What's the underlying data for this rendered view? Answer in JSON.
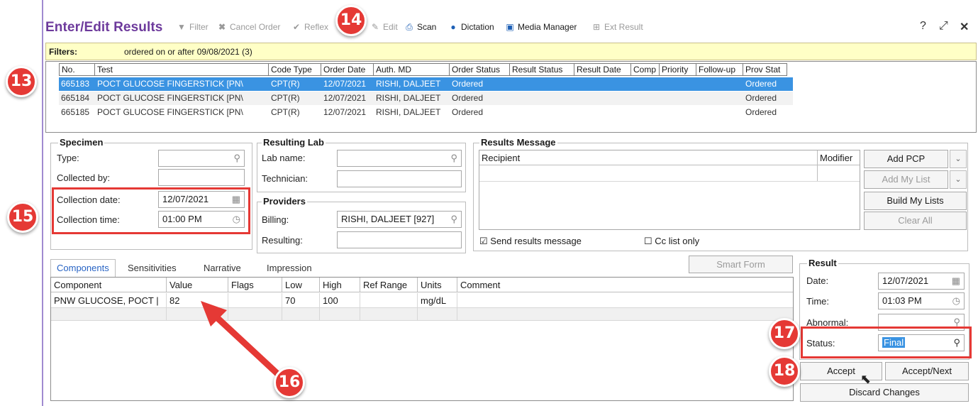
{
  "window": {
    "title": "Enter/Edit Results",
    "toolbar": [
      {
        "label": "Filter",
        "icon": "filter-icon",
        "enabled": false
      },
      {
        "label": "Cancel Order",
        "icon": "x-icon",
        "enabled": false
      },
      {
        "label": "Reflex",
        "icon": "check-arrow-icon",
        "enabled": false
      },
      {
        "label": "Edit",
        "icon": "pencil-icon",
        "enabled": false
      },
      {
        "label": "Scan",
        "icon": "scanner-icon",
        "enabled": true
      },
      {
        "label": "Dictation",
        "icon": "microphone-icon",
        "enabled": true
      },
      {
        "label": "Media Manager",
        "icon": "media-icon",
        "enabled": true
      },
      {
        "label": "Ext Result",
        "icon": "plus-box-icon",
        "enabled": false
      }
    ],
    "controls": {
      "help": "?",
      "maximize": "⤢",
      "close": "✕"
    }
  },
  "filters": {
    "label": "Filters:",
    "value": "ordered on or after 09/08/2021 (3)"
  },
  "orders": {
    "columns": [
      "No.",
      "Test",
      "Code Type",
      "Order Date",
      "Auth. MD",
      "Order Status",
      "Result Status",
      "Result Date",
      "Comp",
      "Priority",
      "Follow-up",
      "Prov Stat"
    ],
    "rows": [
      {
        "no": "665183",
        "test": "POCT GLUCOSE FINGERSTICK [PN\\",
        "code_type": "CPT(R)",
        "order_date": "12/07/2021",
        "auth_md": "RISHI, DALJEET",
        "order_status": "Ordered",
        "prov_stat": "Ordered",
        "selected": true
      },
      {
        "no": "665184",
        "test": "POCT GLUCOSE FINGERSTICK [PN\\",
        "code_type": "CPT(R)",
        "order_date": "12/07/2021",
        "auth_md": "RISHI, DALJEET",
        "order_status": "Ordered",
        "prov_stat": "Ordered",
        "selected": false
      },
      {
        "no": "665185",
        "test": "POCT GLUCOSE FINGERSTICK [PN\\",
        "code_type": "CPT(R)",
        "order_date": "12/07/2021",
        "auth_md": "RISHI, DALJEET",
        "order_status": "Ordered",
        "prov_stat": "Ordered",
        "selected": false
      }
    ]
  },
  "specimen": {
    "legend": "Specimen",
    "type_label": "Type:",
    "type_value": "",
    "collected_by_label": "Collected by:",
    "collected_by_value": "",
    "collection_date_label": "Collection date:",
    "collection_date_value": "12/07/2021",
    "collection_time_label": "Collection time:",
    "collection_time_value": "01:00 PM"
  },
  "resulting_lab": {
    "legend": "Resulting Lab",
    "lab_name_label": "Lab name:",
    "lab_name_value": "",
    "technician_label": "Technician:",
    "technician_value": ""
  },
  "providers": {
    "legend": "Providers",
    "billing_label": "Billing:",
    "billing_value": "RISHI, DALJEET [927]",
    "resulting_label": "Resulting:",
    "resulting_value": ""
  },
  "results_message": {
    "legend": "Results Message",
    "recipient_header": "Recipient",
    "modifier_header": "Modifier",
    "buttons": {
      "add_pcp": "Add PCP",
      "add_my_list": "Add My List",
      "build_my_lists": "Build My Lists",
      "clear_all": "Clear All"
    },
    "send_results_label": "Send results message",
    "send_results_checked": true,
    "cc_list_label": "Cc list only",
    "cc_list_checked": false
  },
  "tabs": [
    "Components",
    "Sensitivities",
    "Narrative",
    "Impression"
  ],
  "smart_form": "Smart Form",
  "components": {
    "columns": [
      "Component",
      "Value",
      "Flags",
      "Low",
      "High",
      "Ref Range",
      "Units",
      "Comment"
    ],
    "rows": [
      {
        "component": "PNW GLUCOSE, POCT |",
        "value": "82",
        "flags": "",
        "low": "70",
        "high": "100",
        "ref_range": "",
        "units": "mg/dL",
        "comment": ""
      }
    ]
  },
  "result": {
    "legend": "Result",
    "date_label": "Date:",
    "date_value": "12/07/2021",
    "time_label": "Time:",
    "time_value": "01:03 PM",
    "abnormal_label": "Abnormal:",
    "abnormal_value": "",
    "status_label": "Status:",
    "status_value": "Final",
    "buttons": {
      "accept": "Accept",
      "accept_next": "Accept/Next",
      "discard": "Discard Changes"
    }
  },
  "callouts": [
    "13",
    "14",
    "15",
    "16",
    "17",
    "18"
  ],
  "colors": {
    "title": "#6d3a9c",
    "selection": "#3a93e2",
    "filter_bg": "#ffffc6",
    "callout": "#e53935"
  }
}
